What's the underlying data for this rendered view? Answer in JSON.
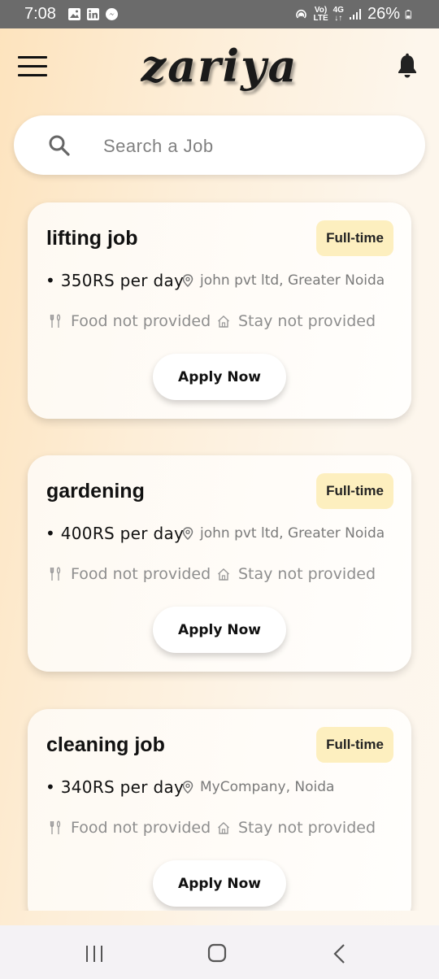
{
  "status_bar": {
    "time": "7:08",
    "volte_line1": "Vo)",
    "volte_line2": "LTE",
    "network_line1": "4G",
    "network_line2": "↓↑",
    "battery": "26%"
  },
  "header": {
    "logo_text": "zariya"
  },
  "search": {
    "placeholder": "Search a Job"
  },
  "jobs": [
    {
      "title": "lifting job",
      "type": "Full-time",
      "pay": "• 350RS per day",
      "location": "john pvt ltd, Greater Noida",
      "food": "Food not provided",
      "stay": "Stay not provided",
      "apply_label": "Apply Now"
    },
    {
      "title": "gardening",
      "type": "Full-time",
      "pay": "• 400RS per day",
      "location": "john pvt ltd, Greater Noida",
      "food": "Food not provided",
      "stay": "Stay not provided",
      "apply_label": "Apply Now"
    },
    {
      "title": "cleaning job",
      "type": "Full-time",
      "pay": "• 340RS per day",
      "location": "MyCompany, Noida",
      "food": "Food not provided",
      "stay": "Stay not provided",
      "apply_label": "Apply Now"
    }
  ],
  "colors": {
    "badge_bg": "#fdefbf",
    "status_bar_bg": "#6b6b6b",
    "nav_bar_bg": "#f4f2f5"
  },
  "icons": {
    "menu": "hamburger-menu-icon",
    "bell": "bell-icon",
    "search": "search-icon",
    "location": "location-pin-icon",
    "food": "fork-knife-icon",
    "stay": "home-icon"
  }
}
